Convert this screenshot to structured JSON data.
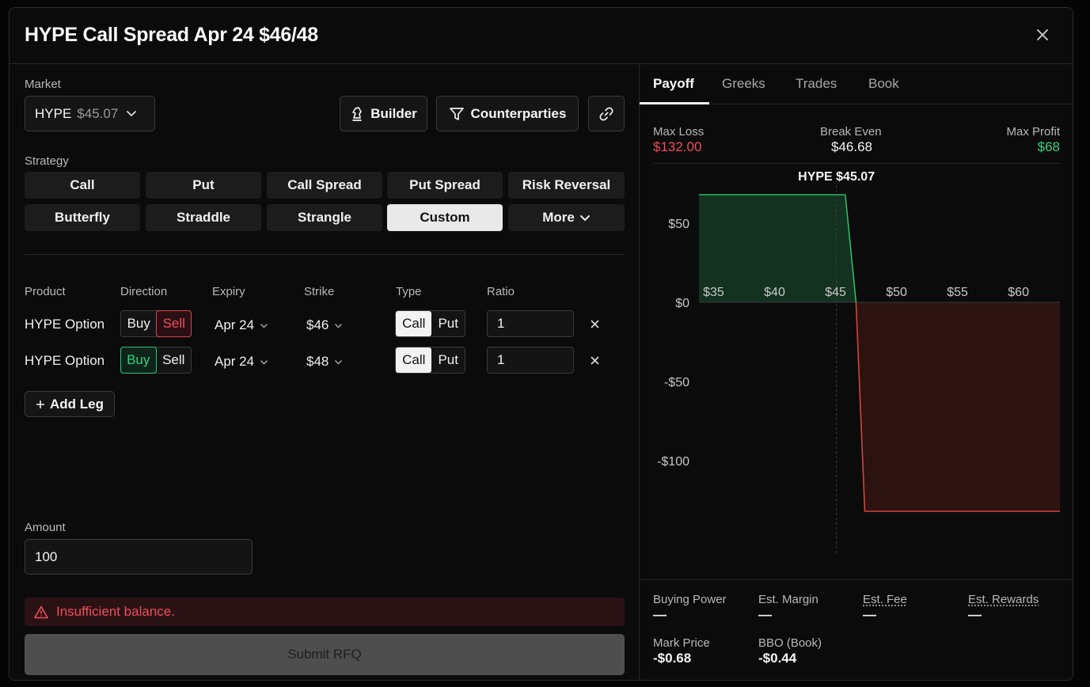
{
  "modal": {
    "title": "HYPE Call Spread Apr 24 $46/48"
  },
  "market": {
    "label": "Market",
    "symbol": "HYPE",
    "price": "$45.07"
  },
  "toolbar": {
    "builder_label": "Builder",
    "counterparties_label": "Counterparties"
  },
  "strategy": {
    "label": "Strategy",
    "options": [
      "Call",
      "Put",
      "Call Spread",
      "Put Spread",
      "Risk Reversal",
      "Butterfly",
      "Straddle",
      "Strangle",
      "Custom",
      "More"
    ],
    "selected": "Custom"
  },
  "legs": {
    "headers": {
      "product": "Product",
      "direction": "Direction",
      "expiry": "Expiry",
      "strike": "Strike",
      "type": "Type",
      "ratio": "Ratio"
    },
    "rows": [
      {
        "product": "HYPE Option",
        "buy": "Buy",
        "sell": "Sell",
        "direction": "Sell",
        "expiry": "Apr 24",
        "strike": "$46",
        "call": "Call",
        "put": "Put",
        "type": "Call",
        "ratio": "1"
      },
      {
        "product": "HYPE Option",
        "buy": "Buy",
        "sell": "Sell",
        "direction": "Buy",
        "expiry": "Apr 24",
        "strike": "$48",
        "call": "Call",
        "put": "Put",
        "type": "Call",
        "ratio": "1"
      }
    ],
    "add_leg_label": "Add Leg"
  },
  "amount": {
    "label": "Amount",
    "value": "100"
  },
  "alert": {
    "message": "Insufficient balance."
  },
  "submit": {
    "label": "Submit RFQ"
  },
  "tabs": [
    "Payoff",
    "Greeks",
    "Trades",
    "Book"
  ],
  "active_tab": "Payoff",
  "stats": {
    "max_loss_label": "Max Loss",
    "max_loss": "$132.00",
    "break_even_label": "Break Even",
    "break_even": "$46.68",
    "max_profit_label": "Max Profit",
    "max_profit": "$68"
  },
  "colors": {
    "loss": "#ef4e5c",
    "profit": "#34d17f"
  },
  "chart_data": {
    "type": "area",
    "marker_label": "HYPE $45.07",
    "marker_x": 45.07,
    "x_ticks": [
      "$35",
      "$40",
      "$45",
      "$50",
      "$55",
      "$60"
    ],
    "y_ticks": [
      "$50",
      "$0",
      "-$50",
      "-$100"
    ],
    "x_tick_values": [
      35,
      40,
      45,
      50,
      55,
      60
    ],
    "y_tick_values": [
      50,
      0,
      -50,
      -100
    ],
    "xlim": [
      33.8,
      63.4
    ],
    "ylim": [
      -132,
      68
    ],
    "points": [
      [
        33.8,
        68
      ],
      [
        45.8,
        68
      ],
      [
        46.68,
        0
      ],
      [
        47.4,
        -132
      ],
      [
        63.4,
        -132
      ]
    ]
  },
  "summary": {
    "buying_power_label": "Buying Power",
    "buying_power": "—",
    "est_margin_label": "Est. Margin",
    "est_margin": "—",
    "est_fee_label": "Est. Fee",
    "est_fee": "—",
    "est_rewards_label": "Est. Rewards",
    "est_rewards": "—",
    "mark_price_label": "Mark Price",
    "mark_price": "-$0.68",
    "bbo_label": "BBO (Book)",
    "bbo": "-$0.44"
  }
}
